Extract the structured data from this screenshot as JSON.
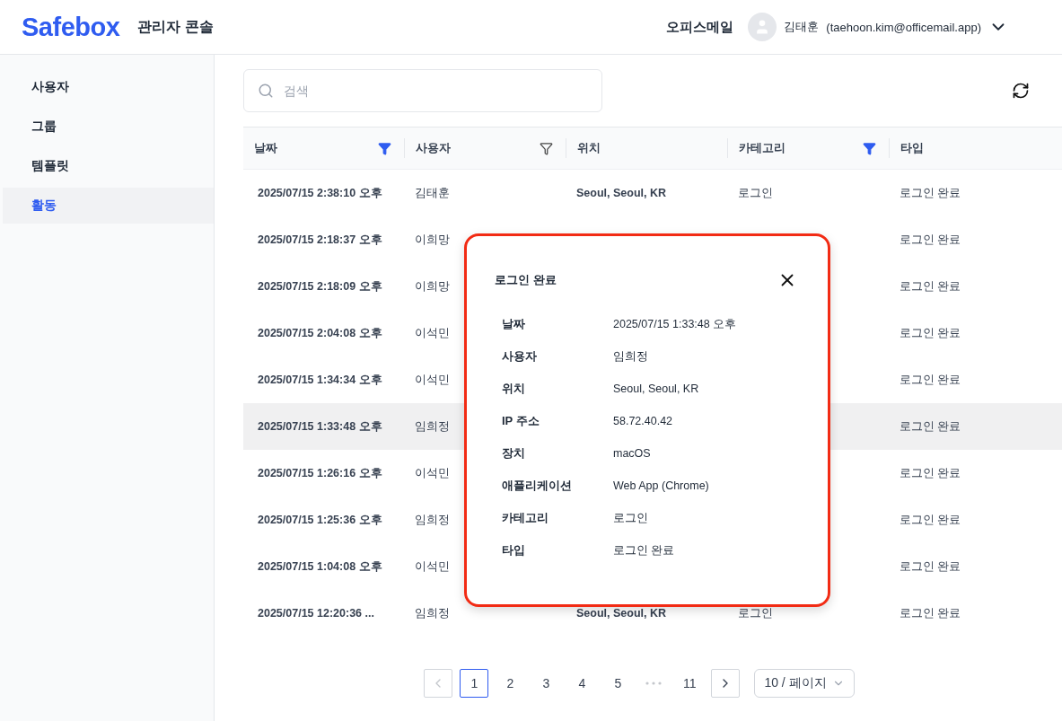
{
  "header": {
    "logo": "Safebox",
    "subtitle": "관리자 콘솔",
    "org": "오피스메일",
    "user_name": "김태훈",
    "user_email": "(taehoon.kim@officemail.app)"
  },
  "sidebar": {
    "items": [
      {
        "label": "사용자",
        "selected": false
      },
      {
        "label": "그룹",
        "selected": false
      },
      {
        "label": "템플릿",
        "selected": false
      },
      {
        "label": "활동",
        "selected": true
      }
    ]
  },
  "search": {
    "placeholder": "검색"
  },
  "table": {
    "columns": [
      {
        "label": "날짜",
        "filter_active": true
      },
      {
        "label": "사용자",
        "filter_active": false
      },
      {
        "label": "위치"
      },
      {
        "label": "카테고리",
        "filter_active": true
      },
      {
        "label": "타입"
      }
    ],
    "rows": [
      {
        "date": "2025/07/15 2:38:10 오후",
        "user": "김태훈",
        "location": "Seoul, Seoul, KR",
        "category": "로그인",
        "type": "로그인 완료",
        "selected": false
      },
      {
        "date": "2025/07/15 2:18:37 오후",
        "user": "이희망",
        "type": "로그인 완료",
        "selected": false
      },
      {
        "date": "2025/07/15 2:18:09 오후",
        "user": "이희망",
        "type": "로그인 완료",
        "selected": false
      },
      {
        "date": "2025/07/15 2:04:08 오후",
        "user": "이석민",
        "type": "로그인 완료",
        "selected": false
      },
      {
        "date": "2025/07/15 1:34:34 오후",
        "user": "이석민",
        "type": "로그인 완료",
        "selected": false
      },
      {
        "date": "2025/07/15 1:33:48 오후",
        "user": "임희정",
        "type": "로그인 완료",
        "selected": true
      },
      {
        "date": "2025/07/15 1:26:16 오후",
        "user": "이석민",
        "type": "로그인 완료",
        "selected": false
      },
      {
        "date": "2025/07/15 1:25:36 오후",
        "user": "임희정",
        "type": "로그인 완료",
        "selected": false
      },
      {
        "date": "2025/07/15 1:04:08 오후",
        "user": "이석민",
        "type": "로그인 완료",
        "selected": false
      },
      {
        "date": "2025/07/15 12:20:36 ...",
        "user": "임희정",
        "location": "Seoul, Seoul, KR",
        "category": "로그인",
        "type": "로그인 완료",
        "selected": false
      }
    ]
  },
  "pagination": {
    "pages": [
      {
        "label": "1",
        "selected": true
      },
      {
        "label": "2",
        "selected": false
      },
      {
        "label": "3",
        "selected": false
      },
      {
        "label": "4",
        "selected": false
      },
      {
        "label": "5",
        "selected": false
      },
      {
        "label": "11",
        "selected": false
      }
    ],
    "prev_disabled": true,
    "next_disabled": false,
    "page_size": "10 / 페이지"
  },
  "modal": {
    "title": "로그인 완료",
    "fields": [
      {
        "label": "날짜",
        "value": "2025/07/15 1:33:48 오후"
      },
      {
        "label": "사용자",
        "value": "임희정"
      },
      {
        "label": "위치",
        "value": "Seoul, Seoul, KR"
      },
      {
        "label": "IP 주소",
        "value": "58.72.40.42"
      },
      {
        "label": "장치",
        "value": "macOS"
      },
      {
        "label": "애플리케이션",
        "value": "Web App (Chrome)"
      },
      {
        "label": "카테고리",
        "value": "로그인"
      },
      {
        "label": "타입",
        "value": "로그인 완료"
      }
    ]
  }
}
